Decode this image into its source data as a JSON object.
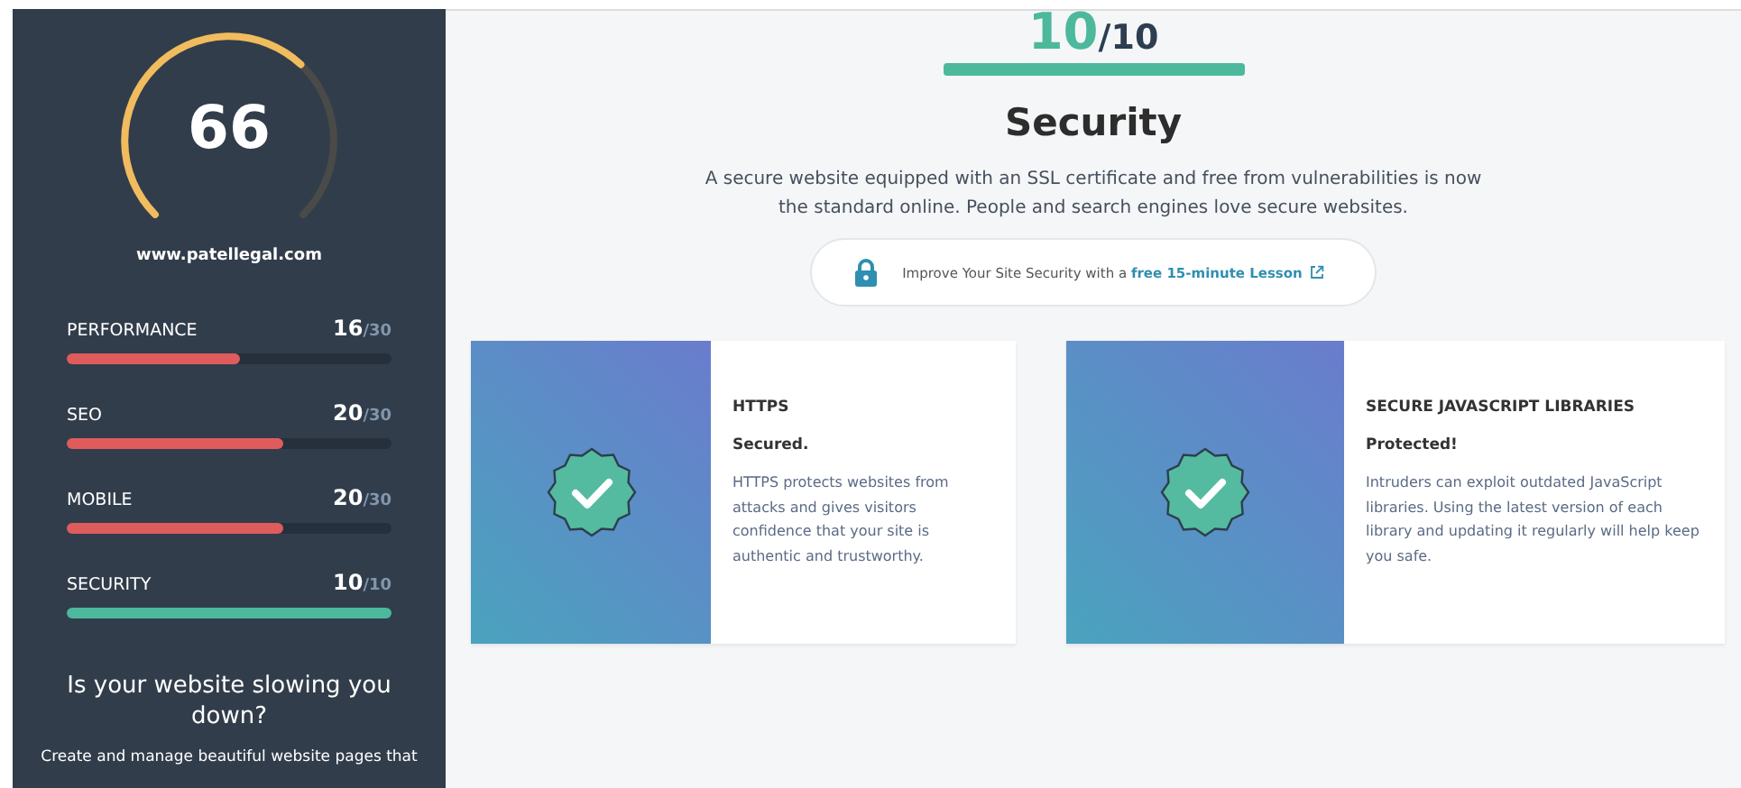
{
  "sidebar": {
    "gauge": {
      "score": "66"
    },
    "site": "www.patellegal.com",
    "metrics": [
      {
        "name": "PERFORMANCE",
        "score": "16",
        "max": "/30",
        "level": 0.533,
        "color": "#e05c5c"
      },
      {
        "name": "SEO",
        "score": "20",
        "max": "/30",
        "level": 0.667,
        "color": "#e05c5c"
      },
      {
        "name": "MOBILE",
        "score": "20",
        "max": "/30",
        "level": 0.667,
        "color": "#e05c5c"
      },
      {
        "name": "SECURITY",
        "score": "10",
        "max": "/10",
        "level": 1,
        "color": "#4cb89c"
      }
    ],
    "promo_title": "Is your website slowing you down?",
    "promo_text": "Create and manage beautiful website pages that"
  },
  "main": {
    "score": "10",
    "max": "/10",
    "level": 1,
    "title": "Security",
    "description": "A secure website equipped with an SSL certificate and free from vulnerabilities is now the standard online. People and search engines love secure websites.",
    "lesson": {
      "text": "Improve Your Site Security with a ",
      "link": "free 15-minute Lesson"
    },
    "cards": [
      {
        "title": "HTTPS",
        "status": "Secured.",
        "text": "HTTPS protects websites from attacks and gives visitors confidence that your site is authentic and trustworthy."
      },
      {
        "title": "SECURE JAVASCRIPT LIBRARIES",
        "status": "Protected!",
        "text": "Intruders can exploit outdated JavaScript libraries. Using the latest version of each library and updating it regularly will help keep you safe."
      }
    ]
  }
}
